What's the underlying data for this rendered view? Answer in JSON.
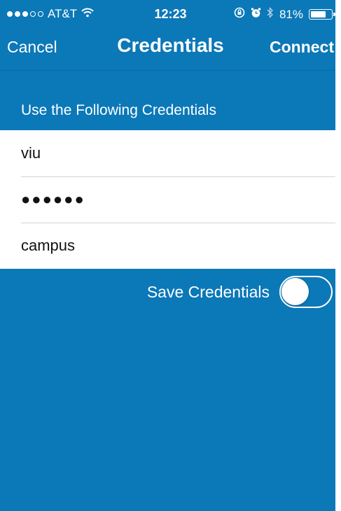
{
  "status_bar": {
    "carrier": "AT&T",
    "signal_full_dots": 3,
    "signal_total_dots": 5,
    "time": "12:23",
    "battery_percent_text": "81%",
    "battery_level": 0.81
  },
  "nav": {
    "cancel_label": "Cancel",
    "title": "Credentials",
    "connect_label": "Connect"
  },
  "section": {
    "header": "Use the Following Credentials"
  },
  "fields": {
    "username": "viu",
    "password_mask": "●●●●●●",
    "domain": "campus"
  },
  "save": {
    "label": "Save Credentials",
    "enabled": false
  },
  "colors": {
    "primary_blue": "#0b78b8",
    "field_background": "#ffffff",
    "text": "#111111"
  },
  "icons": [
    "wifi-icon",
    "lock-rotation-icon",
    "alarm-icon",
    "bluetooth-icon",
    "battery-icon"
  ]
}
